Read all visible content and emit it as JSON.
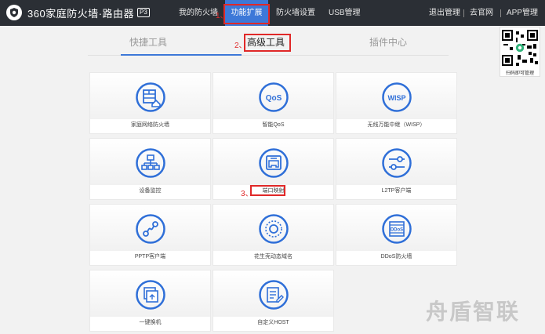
{
  "topbar": {
    "brand": "360家庭防火墙·路由器",
    "model": "P3",
    "nav": [
      "我的防火墙",
      "功能扩展",
      "防火墙设置",
      "USB管理"
    ],
    "step1": "1、",
    "right_links": [
      "退出管理",
      "去官网",
      "APP管理"
    ]
  },
  "tabs": {
    "items": [
      "快捷工具",
      "高级工具",
      "插件中心"
    ],
    "step2": "2、"
  },
  "cards": [
    {
      "label": "家庭网络防火墙",
      "icon": "firewall-house-icon"
    },
    {
      "label": "智能QoS",
      "icon": "qos-icon"
    },
    {
      "label": "无线万能中继（WISP）",
      "icon": "wisp-icon"
    },
    {
      "label": "设备监控",
      "icon": "network-topology-icon"
    },
    {
      "label": "端口映射",
      "icon": "port-mapping-icon"
    },
    {
      "label": "L2TP客户端",
      "icon": "sliders-icon"
    },
    {
      "label": "PPTP客户端",
      "icon": "link-node-icon"
    },
    {
      "label": "花生壳动态域名",
      "icon": "dynamic-dns-icon"
    },
    {
      "label": "DDoS防火墙",
      "icon": "ddos-icon"
    },
    {
      "label": "一键换机",
      "icon": "device-swap-icon"
    },
    {
      "label": "自定义HOST",
      "icon": "custom-host-icon"
    }
  ],
  "icon_texts": {
    "qos": "QoS",
    "wisp": "WISP",
    "ddos": "DDoS"
  },
  "step3": "3、",
  "qr": {
    "label": "扫码即可管理"
  },
  "watermark": "舟盾智联",
  "colors": {
    "topbar": "#2b2f35",
    "accent": "#3d78d8",
    "icon_blue": "#2f6fd8",
    "highlight_red": "#e02828"
  }
}
